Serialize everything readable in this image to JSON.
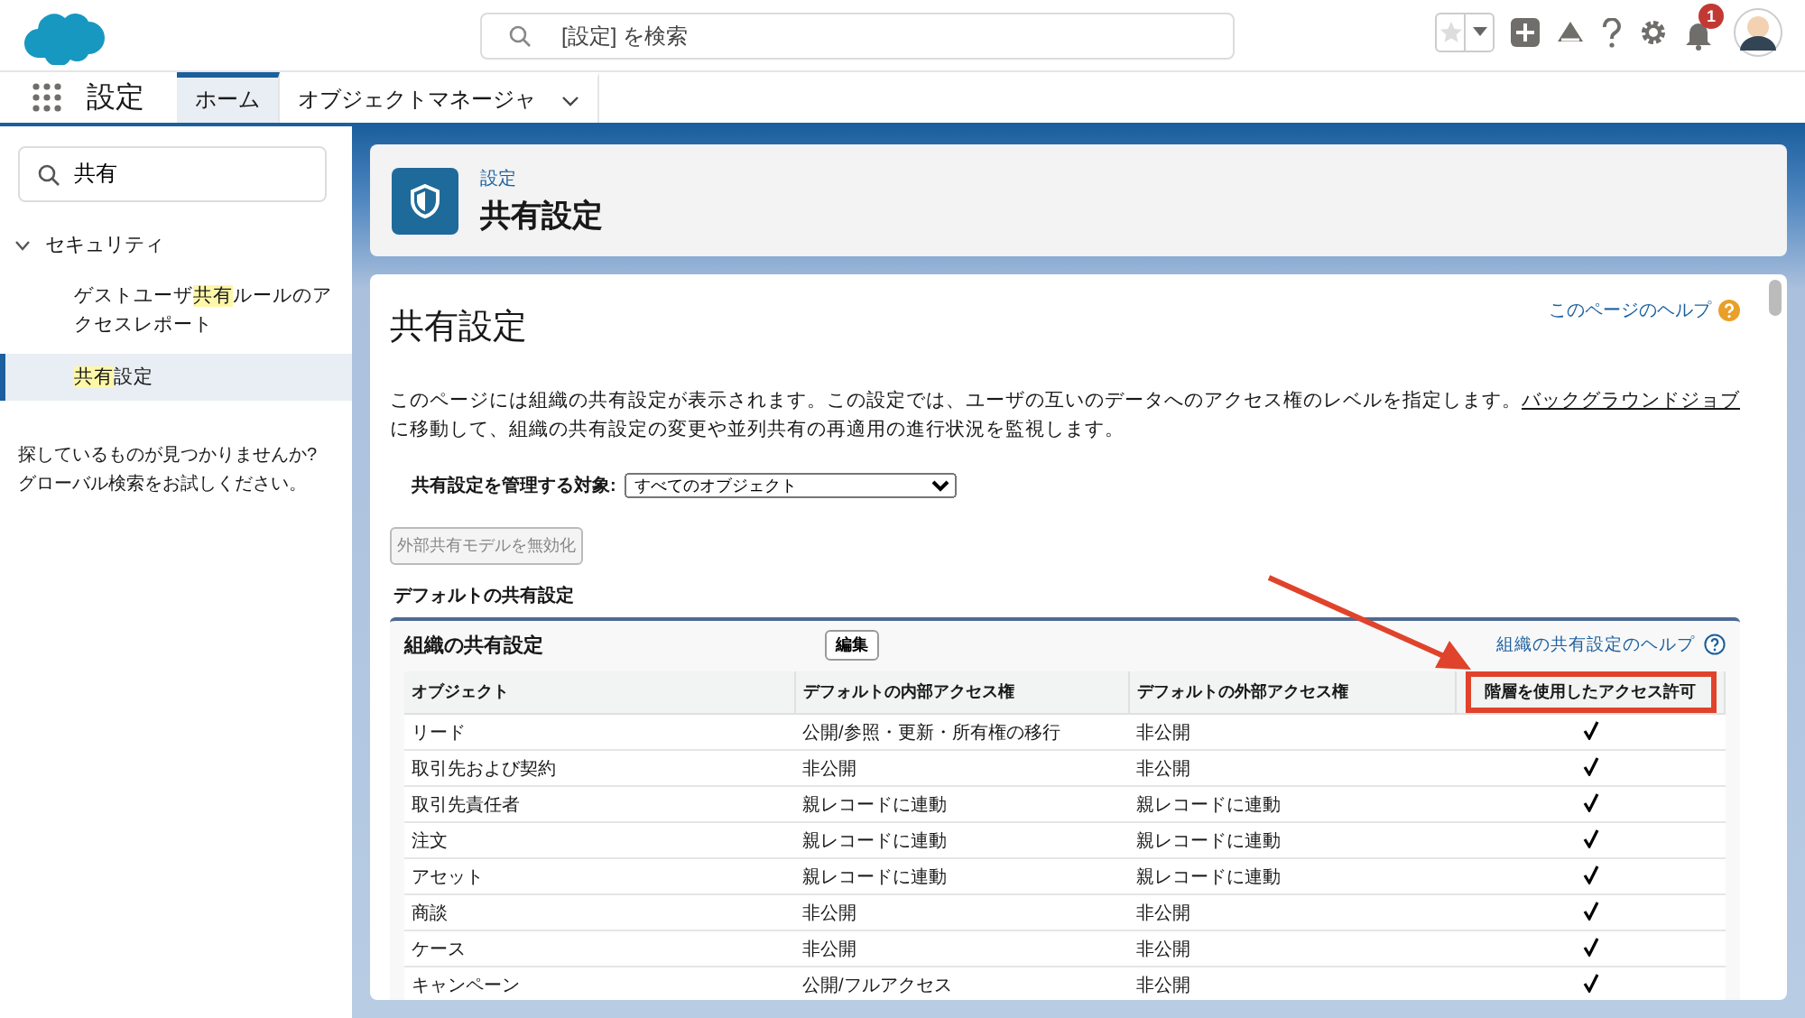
{
  "header": {
    "search_placeholder": "[設定] を検索",
    "notification_count": "1"
  },
  "nav": {
    "app_name": "設定",
    "tabs": [
      {
        "label": "ホーム",
        "selected": true,
        "has_menu": false
      },
      {
        "label": "オブジェクトマネージャ",
        "selected": false,
        "has_menu": true
      }
    ]
  },
  "sidebar": {
    "search_value": "共有",
    "tree": [
      {
        "label": "セキュリティ",
        "expanded": true,
        "children": [
          {
            "parts": [
              {
                "text": "ゲストユーザ",
                "highlight": false
              },
              {
                "text": "共有",
                "highlight": true
              },
              {
                "text": "ルールのアクセスレポート",
                "highlight": false
              }
            ],
            "selected": false
          },
          {
            "parts": [
              {
                "text": "共有",
                "highlight": true
              },
              {
                "text": "設定",
                "highlight": false
              }
            ],
            "selected": true
          }
        ]
      }
    ],
    "hint_lines": [
      "探しているものが見つかりませんか?",
      "グローバル検索をお試しください。"
    ]
  },
  "page_header": {
    "breadcrumb": "設定",
    "title": "共有設定"
  },
  "content": {
    "title": "共有設定",
    "help_link": "このページのヘルプ",
    "description": {
      "before": "このページには組織の共有設定が表示されます。この設定では、ユーザの互いのデータへのアクセス権のレベルを指定します。",
      "link": "バックグラウンドジョブ",
      "after": "に移動して、組織の共有設定の変更や並列共有の再適用の進行状況を監視します。"
    },
    "manage_label": "共有設定を管理する対象:",
    "manage_value": "すべてのオブジェクト",
    "disable_button": {
      "label": "外部共有モデルを無効化",
      "disabled": true
    },
    "section_title": "デフォルトの共有設定",
    "table_block": {
      "title": "組織の共有設定",
      "edit_button": "編集",
      "help_link": "組織の共有設定のヘルプ",
      "columns": [
        {
          "label": "オブジェクト",
          "highlighted": false
        },
        {
          "label": "デフォルトの内部アクセス権",
          "highlighted": false
        },
        {
          "label": "デフォルトの外部アクセス権",
          "highlighted": false
        },
        {
          "label": "階層を使用したアクセス許可",
          "highlighted": true
        }
      ],
      "rows": [
        {
          "object": "リード",
          "internal": "公開/参照・更新・所有権の移行",
          "external": "非公開",
          "hierarchy": true
        },
        {
          "object": "取引先および契約",
          "internal": "非公開",
          "external": "非公開",
          "hierarchy": true
        },
        {
          "object": "取引先責任者",
          "internal": "親レコードに連動",
          "external": "親レコードに連動",
          "hierarchy": true
        },
        {
          "object": "注文",
          "internal": "親レコードに連動",
          "external": "親レコードに連動",
          "hierarchy": true
        },
        {
          "object": "アセット",
          "internal": "親レコードに連動",
          "external": "親レコードに連動",
          "hierarchy": true
        },
        {
          "object": "商談",
          "internal": "非公開",
          "external": "非公開",
          "hierarchy": true
        },
        {
          "object": "ケース",
          "internal": "非公開",
          "external": "非公開",
          "hierarchy": true
        },
        {
          "object": "キャンペーン",
          "internal": "公開/フルアクセス",
          "external": "非公開",
          "hierarchy": true
        }
      ]
    }
  }
}
